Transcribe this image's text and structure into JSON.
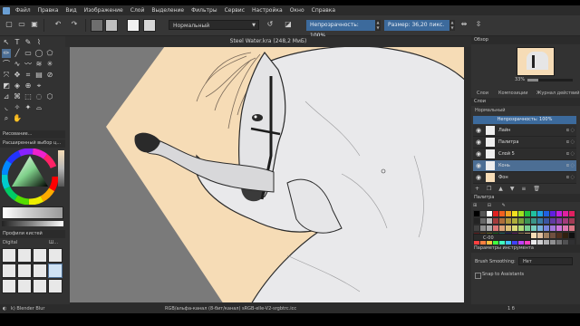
{
  "menu": [
    "Файл",
    "Правка",
    "Вид",
    "Изображение",
    "Слой",
    "Выделение",
    "Фильтры",
    "Сервис",
    "Настройка",
    "Окно",
    "Справка"
  ],
  "toolbar": {
    "blend_mode": "Нормальный",
    "opacity_label": "Непрозрачность: 100%",
    "size_label": "Размер: 36,20 пикс."
  },
  "canvas": {
    "title": "Steel Water.kra (248,2 МиБ)"
  },
  "left": {
    "tool_options_title": "Рисование...",
    "advanced_color_title": "Расширенный выбор ц...",
    "brush_presets_title": "Профили кистей",
    "preset_tag": "Digital",
    "preset_tab": "Ш..."
  },
  "right": {
    "overview_title": "Обзор",
    "zoom_label": "33%",
    "tabs": [
      "Слои",
      "Композиции",
      "Журнал действий"
    ],
    "layers_title": "Слои",
    "layers_mode": "Нормальный",
    "layers_opacity": "Непрозрачность: 100%",
    "layers": [
      {
        "name": "Лайн",
        "selected": false
      },
      {
        "name": "Палитра",
        "selected": false
      },
      {
        "name": "Слой 5",
        "selected": false
      },
      {
        "name": "Конь",
        "selected": true
      },
      {
        "name": "Фон",
        "selected": false
      }
    ],
    "palette_title": "Палитра",
    "palette_field": "С-00",
    "tool_params_title": "Параметры инструмента",
    "brush_smoothing_label": "Brush Smoothing:",
    "brush_smoothing_value": "Нет",
    "snap_label": "Snap to Assistants"
  },
  "status": {
    "brush_name": "k) Blender Blur",
    "color_info": "RGB/альфа-канал (8-бит/канал)  sRGB-elle-V2-srgbtrc.icc",
    "page": "1 б"
  },
  "colors": {
    "accent": "#4c6e94",
    "canvas_bg": "#f6dcb6",
    "horse": "#e8e8ea"
  }
}
